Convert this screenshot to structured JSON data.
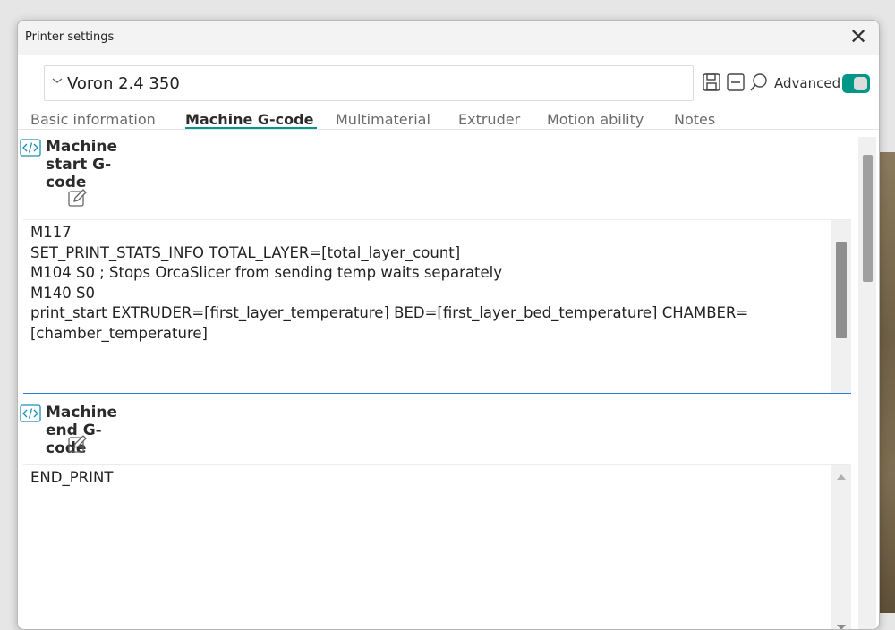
{
  "window": {
    "title": "Printer settings"
  },
  "preset": {
    "name": "Voron 2.4 350"
  },
  "toolbar": {
    "advanced_label": "Advanced",
    "advanced_enabled": true
  },
  "tabs": [
    {
      "label": "Basic information",
      "active": false
    },
    {
      "label": "Machine G-code",
      "active": true
    },
    {
      "label": "Multimaterial",
      "active": false
    },
    {
      "label": "Extruder",
      "active": false
    },
    {
      "label": "Motion ability",
      "active": false
    },
    {
      "label": "Notes",
      "active": false
    }
  ],
  "sections": {
    "start": {
      "title": "Machine start G-code",
      "code": "M117\nSET_PRINT_STATS_INFO TOTAL_LAYER=[total_layer_count]\nM104 S0 ; Stops OrcaSlicer from sending temp waits separately\nM140 S0\nprint_start EXTRUDER=[first_layer_temperature] BED=[first_layer_bed_temperature] CHAMBER=[chamber_temperature]"
    },
    "end": {
      "title": "Machine end G-code",
      "code": "END_PRINT"
    }
  },
  "colors": {
    "accent": "#009688",
    "focus": "#2e7bd6",
    "code_icon": "#1a8fb5"
  },
  "icons": [
    "chevron-down-icon",
    "save-icon",
    "collapse-icon",
    "search-icon",
    "code-icon",
    "edit-icon",
    "close-icon"
  ]
}
